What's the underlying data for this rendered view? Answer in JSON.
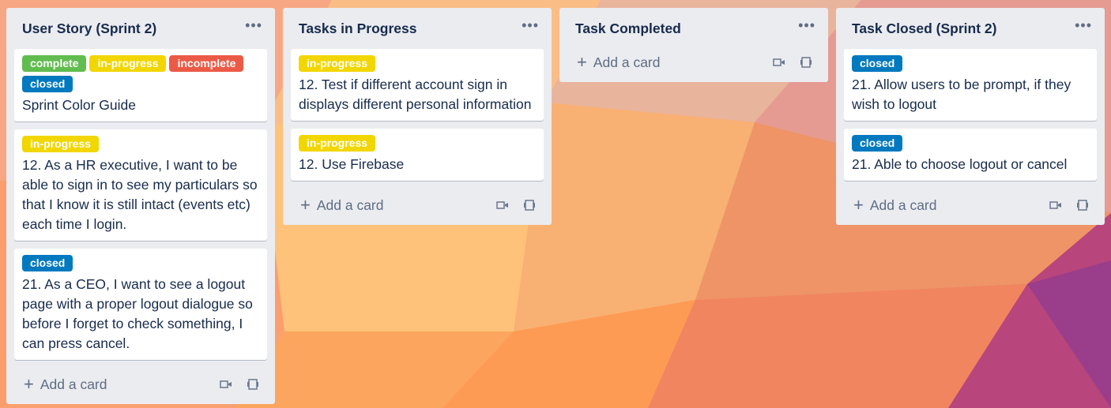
{
  "labels": {
    "complete": {
      "text": "complete",
      "color": "#61bd4f"
    },
    "in_progress": {
      "text": "in-progress",
      "color": "#f2d600"
    },
    "incomplete": {
      "text": "incomplete",
      "color": "#eb5a46"
    },
    "closed": {
      "text": "closed",
      "color": "#0079bf"
    }
  },
  "list_menu_icon": "ellipsis-icon",
  "add_card_label": "Add a card",
  "lists": [
    {
      "title": "User Story (Sprint 2)",
      "cards": [
        {
          "labels": [
            "complete",
            "in-progress",
            "incomplete",
            "closed"
          ],
          "title": "Sprint Color Guide"
        },
        {
          "labels": [
            "in-progress"
          ],
          "title": "12. As a HR executive, I want to be able to sign in to see my particulars so that I know it is still intact (events etc) each time I login."
        },
        {
          "labels": [
            "closed"
          ],
          "title": "21. As a CEO, I want to see a logout page with a proper logout dialogue so before I forget to check something, I can press cancel."
        }
      ]
    },
    {
      "title": "Tasks in Progress",
      "cards": [
        {
          "labels": [
            "in-progress"
          ],
          "title": "12. Test if different account sign in displays different personal information"
        },
        {
          "labels": [
            "in-progress"
          ],
          "title": "12. Use Firebase"
        }
      ]
    },
    {
      "title": "Task Completed",
      "cards": []
    },
    {
      "title": "Task Closed (Sprint 2)",
      "cards": [
        {
          "labels": [
            "closed"
          ],
          "title": "21. Allow users to be prompt, if they wish to logout"
        },
        {
          "labels": [
            "closed"
          ],
          "title": "21. Able to choose logout or cancel"
        }
      ]
    }
  ]
}
